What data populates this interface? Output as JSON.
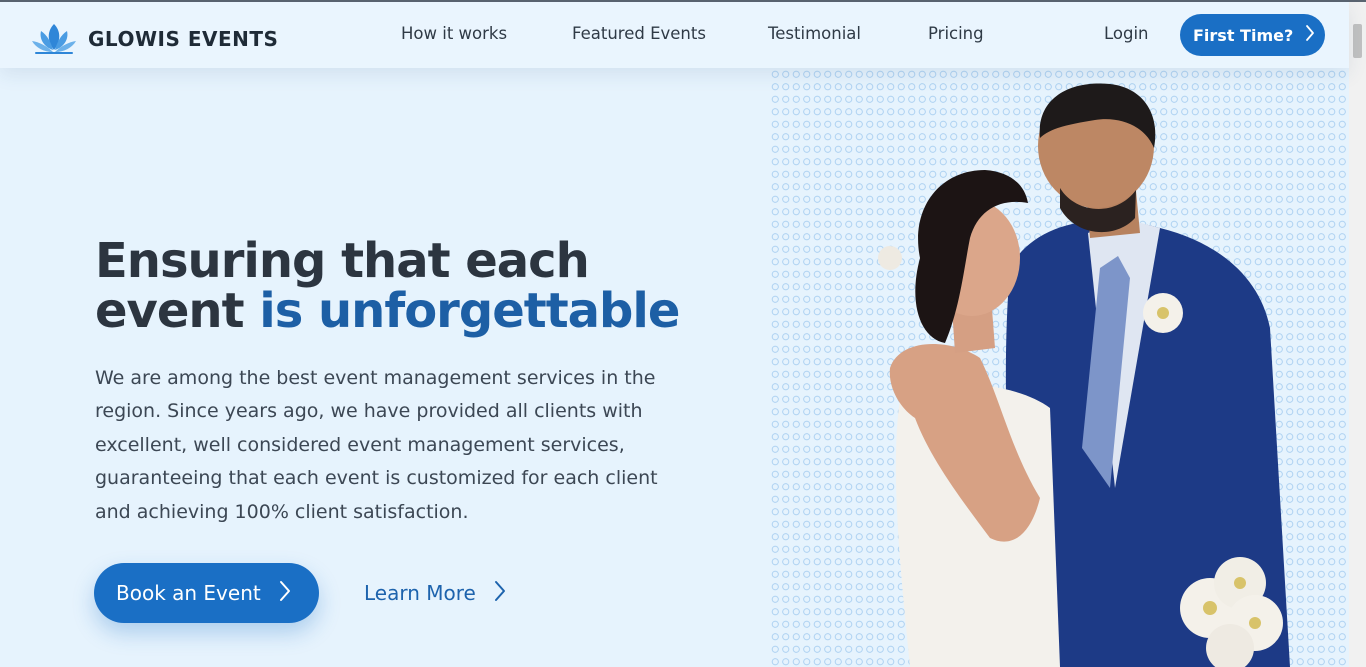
{
  "brand": {
    "name": "GLOWIS EVENTS"
  },
  "nav": {
    "items": [
      {
        "label": "How it works"
      },
      {
        "label": "Featured Events"
      },
      {
        "label": "Testimonial"
      },
      {
        "label": "Pricing"
      }
    ],
    "login": "Login",
    "cta": "First Time?"
  },
  "hero": {
    "headline_part1": "Ensuring that each",
    "headline_part2": "event ",
    "headline_highlight": "is unforgettable",
    "description": "We are among the best event management services in the region. Since years ago, we have provided all clients with excellent, well considered event management services, guaranteeing that each event is customized for each client and achieving 100% client satisfaction.",
    "primary_button": "Book an Event",
    "secondary_button": "Learn More"
  },
  "colors": {
    "accent": "#1a6fc5",
    "headline_highlight": "#1d5fa5",
    "background": "#e6f3fd",
    "text": "#2c3540"
  },
  "icons": {
    "logo": "lotus-logo-icon",
    "cta_chevron": "chevron-right-icon",
    "book_chevron": "chevron-right-icon",
    "learn_chevron": "chevron-right-icon"
  }
}
